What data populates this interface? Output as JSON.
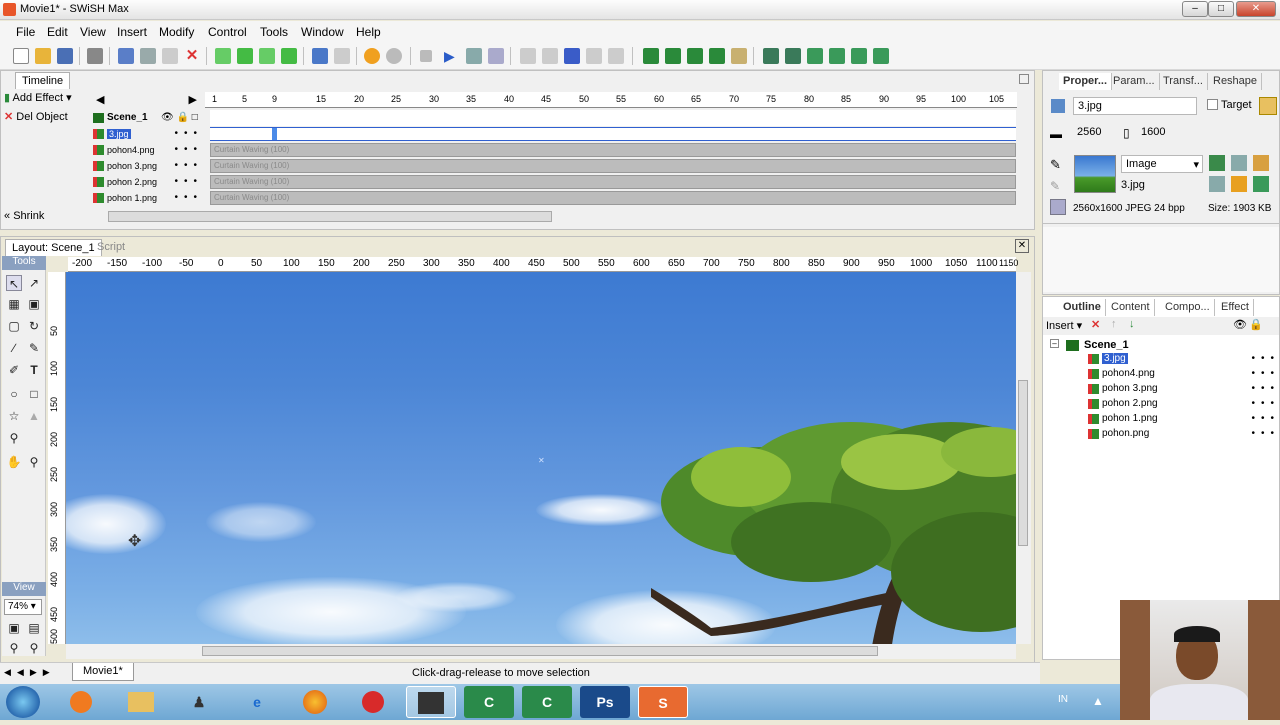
{
  "window": {
    "title": "Movie1* - SWiSH Max"
  },
  "menu": [
    "File",
    "Edit",
    "View",
    "Insert",
    "Modify",
    "Control",
    "Tools",
    "Window",
    "Help"
  ],
  "timeline": {
    "tab": "Timeline",
    "add_effect": "Add Effect",
    "del_object": "Del Object",
    "shrink": "Shrink",
    "frame_ticks": [
      "1",
      "5",
      "9",
      "15",
      "20",
      "25",
      "30",
      "35",
      "40",
      "45",
      "50",
      "55",
      "60",
      "65",
      "70",
      "75",
      "80",
      "85",
      "90",
      "95",
      "100",
      "105"
    ],
    "rows": [
      {
        "name": "Scene_1",
        "track": ""
      },
      {
        "name": "3.jpg",
        "track": ""
      },
      {
        "name": "pohon4.png",
        "track": "Curtain Waving (100)"
      },
      {
        "name": "pohon 3.png",
        "track": "Curtain Waving (100)"
      },
      {
        "name": "pohon 2.png",
        "track": "Curtain Waving (100)"
      },
      {
        "name": "pohon 1.png",
        "track": "Curtain Waving (100)"
      }
    ]
  },
  "layout": {
    "tab_layout": "Layout: Scene_1",
    "tab_script": "Script",
    "tools_label": "Tools",
    "view_label": "View",
    "zoom": "74%",
    "ruler_h": [
      "-200",
      "-150",
      "-100",
      "-50",
      "0",
      "50",
      "100",
      "150",
      "200",
      "250",
      "300",
      "350",
      "400",
      "450",
      "500",
      "550",
      "600",
      "650",
      "700",
      "750",
      "800",
      "850",
      "900",
      "950",
      "1000",
      "1050",
      "1100",
      "1150"
    ],
    "ruler_v": [
      "50",
      "100",
      "150",
      "200",
      "250",
      "300",
      "350",
      "400",
      "450",
      "500"
    ]
  },
  "properties": {
    "tabs": [
      "Proper...",
      "Param...",
      "Transf...",
      "Reshape"
    ],
    "object_name": "3.jpg",
    "target_label": "Target",
    "width": "2560",
    "height": "1600",
    "type": "Image",
    "file": "3.jpg",
    "info": "2560x1600 JPEG 24 bpp",
    "size": "Size: 1903 KB"
  },
  "outline": {
    "tabs": [
      "Outline",
      "Content",
      "Compo...",
      "Effect"
    ],
    "insert_label": "Insert",
    "items": [
      "Scene_1",
      "3.jpg",
      "pohon4.png",
      "pohon 3.png",
      "pohon 2.png",
      "pohon 1.png",
      "pohon.png"
    ]
  },
  "status": {
    "doc_tab": "Movie1*",
    "message": "Click-drag-release to move selection"
  },
  "taskbar": {
    "lang": "IN"
  }
}
